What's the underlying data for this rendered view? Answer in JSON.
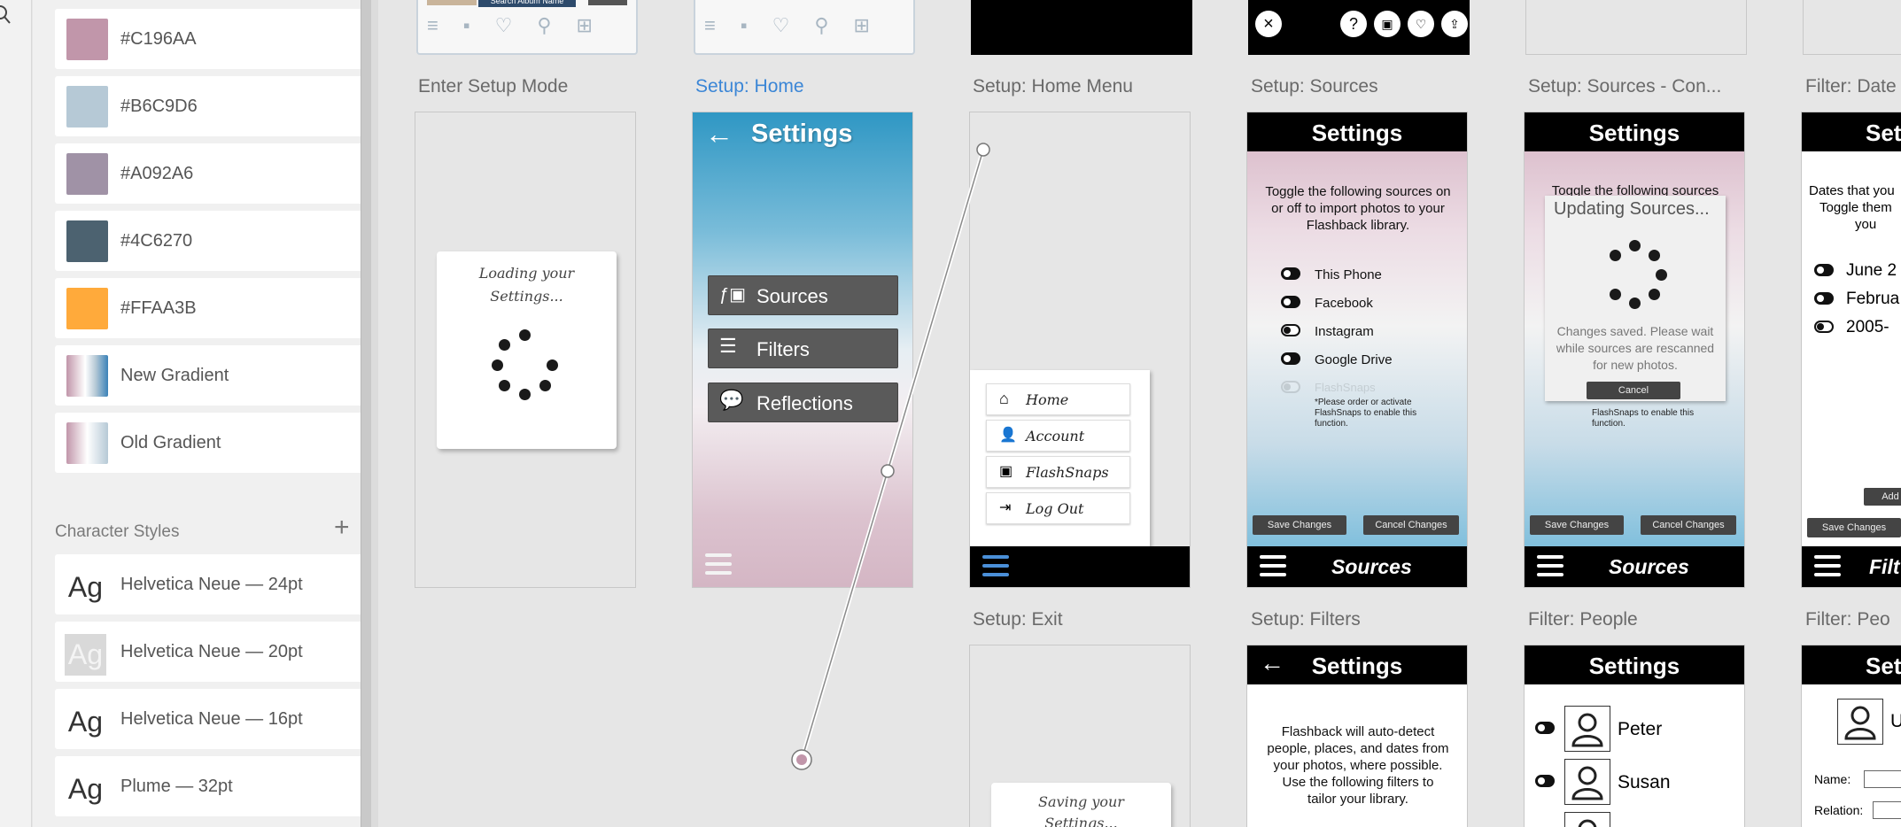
{
  "assets_panel": {
    "colors": [
      {
        "label": "#C196AA",
        "color": "#C196AA"
      },
      {
        "label": "#B6C9D6",
        "color": "#B6C9D6"
      },
      {
        "label": "#A092A6",
        "color": "#A092A6"
      },
      {
        "label": "#4C6270",
        "color": "#4C6270"
      },
      {
        "label": "#FFAA3B",
        "color": "#FFAA3B"
      }
    ],
    "gradients": [
      {
        "label": "New Gradient"
      },
      {
        "label": "Old Gradient"
      }
    ],
    "character_styles_heading": "Character Styles",
    "character_styles": [
      {
        "sample": "Ag",
        "label": "Helvetica Neue — 24pt"
      },
      {
        "sample": "Ag",
        "label": "Helvetica Neue — 20pt"
      },
      {
        "sample": "Ag",
        "label": "Helvetica Neue — 16pt"
      },
      {
        "sample": "Ag",
        "label": "Plume — 32pt"
      }
    ]
  },
  "top_thumb": {
    "search_text": "Search Album Name"
  },
  "artboards": {
    "enter_setup": {
      "label": "Enter Setup Mode",
      "loading": "Loading your Settings..."
    },
    "setup_home": {
      "label": "Setup: Home",
      "title": "Settings",
      "buttons": [
        "Sources",
        "Filters",
        "Reflections"
      ]
    },
    "home_menu": {
      "label": "Setup: Home Menu",
      "items": [
        "Home",
        "Account",
        "FlashSnaps",
        "Log Out"
      ]
    },
    "sources": {
      "label": "Setup: Sources",
      "title": "Settings",
      "intro": "Toggle the following sources on or off to import photos to your Flashback library.",
      "toggles": [
        "This Phone",
        "Facebook",
        "Instagram",
        "Google Drive"
      ],
      "faded_item": "FlashSnaps",
      "note": "*Please order or activate FlashSnaps to enable this function.",
      "save": "Save Changes",
      "cancel": "Cancel Changes",
      "footer": "Sources"
    },
    "sources_confirm": {
      "label": "Setup: Sources - Con...",
      "title": "Settings",
      "intro_top": "Toggle the following sources",
      "dialog_title": "Updating Sources...",
      "dialog_text": "Changes saved. Please wait while sources are rescanned for new photos.",
      "dialog_cancel": "Cancel",
      "note_tail": "FlashSnaps to enable this function.",
      "save": "Save Changes",
      "cancel": "Cancel Changes",
      "footer": "Sources"
    },
    "filter_dates": {
      "label": "Filter: Date",
      "title": "Set",
      "intro1": "Dates that you",
      "intro2": "Toggle them",
      "intro3": "you",
      "items": [
        "June 2",
        "Februa",
        "2005-"
      ],
      "add": "Add",
      "save": "Save Changes",
      "footer": "Filt"
    },
    "exit": {
      "label": "Setup: Exit",
      "saving": "Saving your Settings..."
    },
    "filters": {
      "label": "Setup: Filters",
      "title": "Settings",
      "text": "Flashback will auto-detect people, places, and dates from your photos, where possible. Use the following filters to tailor your library."
    },
    "filter_people": {
      "label": "Filter: People",
      "title": "Settings",
      "people": [
        "Peter",
        "Susan"
      ]
    },
    "filter_people2": {
      "label": "Filter: Peo",
      "title": "Set",
      "name_label": "Name:",
      "relation_label": "Relation:",
      "partial": "U"
    }
  }
}
